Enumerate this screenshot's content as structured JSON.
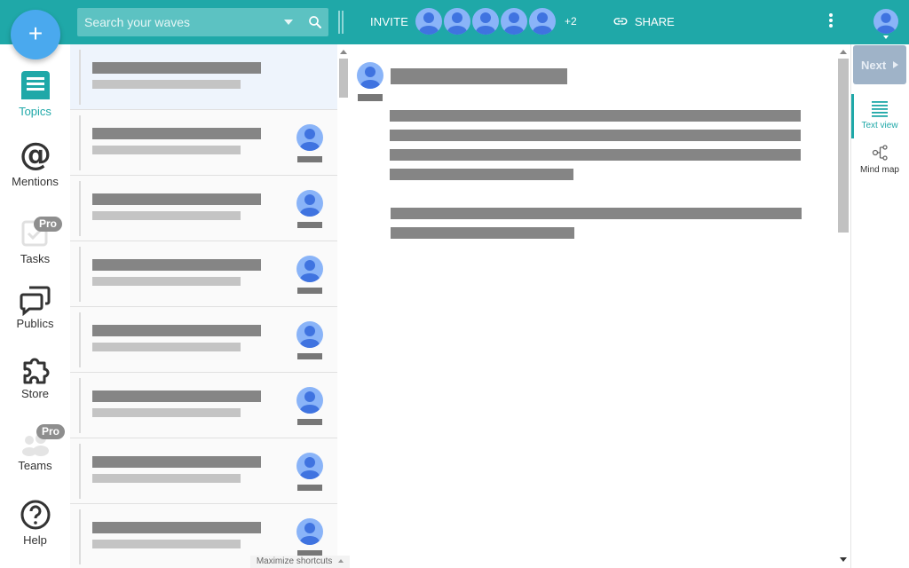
{
  "colors": {
    "topbar": "#1fa8a8",
    "accent": "#1fa8a8",
    "fab": "#4aa9ee",
    "avatar": "#8ab4f8",
    "pro_badge": "#8e8e8e",
    "next_button": "#9fb3c8"
  },
  "fab": {
    "label": "+",
    "icon": "plus-icon"
  },
  "search": {
    "placeholder": "Search your waves",
    "icon": "search-icon"
  },
  "toolbar": {
    "invite_label": "INVITE",
    "participants_extra": "+2",
    "share_label": "SHARE",
    "share_icon": "link-icon",
    "more_icon": "more-vert-icon"
  },
  "nav": {
    "topics": {
      "label": "Topics",
      "icon": "topics-icon"
    },
    "mentions": {
      "label": "Mentions",
      "icon": "at-icon"
    },
    "tasks": {
      "label": "Tasks",
      "icon": "tasks-icon",
      "badge": "Pro"
    },
    "publics": {
      "label": "Publics",
      "icon": "publics-icon"
    },
    "store": {
      "label": "Store",
      "icon": "puzzle-icon"
    },
    "teams": {
      "label": "Teams",
      "icon": "teams-icon",
      "badge": "Pro"
    },
    "help": {
      "label": "Help",
      "icon": "help-icon"
    }
  },
  "footer": {
    "shortcuts_label": "Maximize shortcuts"
  },
  "right_panel": {
    "next_label": "Next",
    "text_view_label": "Text view",
    "mind_map_label": "Mind map"
  }
}
